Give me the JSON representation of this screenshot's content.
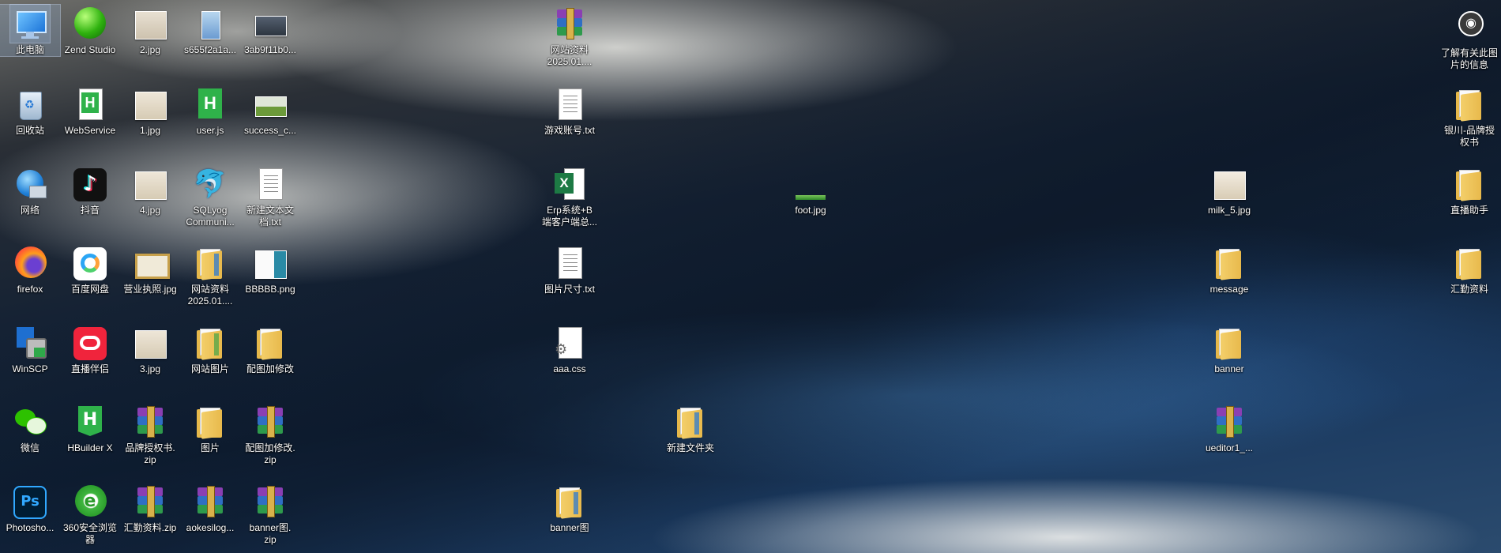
{
  "desktop": {
    "icons": [
      {
        "label": "此电脑",
        "icon": "computer-icon",
        "selected": true
      },
      {
        "label": "Zend Studio",
        "icon": "zend-studio-icon"
      },
      {
        "label": "2.jpg",
        "icon": "image-icon"
      },
      {
        "label": "s655f2a1a...",
        "icon": "image-icon"
      },
      {
        "label": "3ab9f11b0...",
        "icon": "image-icon"
      },
      {
        "label": "网站资料\n2025.01....",
        "icon": "zip-icon"
      },
      {
        "label": "了解有关此图\n片的信息",
        "icon": "info-camera-icon"
      },
      {
        "label": "回收站",
        "icon": "recycle-bin-icon"
      },
      {
        "label": "WebService",
        "icon": "hbuilder-file-icon"
      },
      {
        "label": "1.jpg",
        "icon": "image-icon"
      },
      {
        "label": "user.js",
        "icon": "hbuilder-file-icon"
      },
      {
        "label": "success_c...",
        "icon": "image-icon"
      },
      {
        "label": "游戏账号.txt",
        "icon": "text-file-icon"
      },
      {
        "label": "银川-品牌授\n权书",
        "icon": "folder-icon"
      },
      {
        "label": "网络",
        "icon": "network-icon"
      },
      {
        "label": "抖音",
        "icon": "douyin-icon"
      },
      {
        "label": "4.jpg",
        "icon": "image-icon"
      },
      {
        "label": "SQLyog\nCommuni...",
        "icon": "sqlyog-icon"
      },
      {
        "label": "新建文本文\n档.txt",
        "icon": "text-file-icon"
      },
      {
        "label": "Erp系统+B\n端客户端总...",
        "icon": "excel-icon"
      },
      {
        "label": "foot.jpg",
        "icon": "image-icon"
      },
      {
        "label": "milk_5.jpg",
        "icon": "image-icon"
      },
      {
        "label": "直播助手",
        "icon": "folder-icon"
      },
      {
        "label": "firefox",
        "icon": "firefox-icon"
      },
      {
        "label": "百度网盘",
        "icon": "baidu-netdisk-icon"
      },
      {
        "label": "营业执照.jpg",
        "icon": "image-icon"
      },
      {
        "label": "网站资料\n2025.01....",
        "icon": "folder-icon"
      },
      {
        "label": "BBBBB.png",
        "icon": "image-icon"
      },
      {
        "label": "图片尺寸.txt",
        "icon": "text-file-icon"
      },
      {
        "label": "message",
        "icon": "folder-icon"
      },
      {
        "label": "汇勤资料",
        "icon": "folder-icon"
      },
      {
        "label": "WinSCP",
        "icon": "winscp-icon"
      },
      {
        "label": "直播伴侣",
        "icon": "live-companion-icon"
      },
      {
        "label": "3.jpg",
        "icon": "image-icon"
      },
      {
        "label": "网站图片",
        "icon": "folder-icon"
      },
      {
        "label": "配图加修改",
        "icon": "folder-icon"
      },
      {
        "label": "aaa.css",
        "icon": "css-file-icon"
      },
      {
        "label": "banner",
        "icon": "folder-icon"
      },
      {
        "label": "微信",
        "icon": "wechat-icon"
      },
      {
        "label": "HBuilder X",
        "icon": "hbuilder-icon"
      },
      {
        "label": "品牌授权书.\nzip",
        "icon": "zip-icon"
      },
      {
        "label": "图片",
        "icon": "folder-icon"
      },
      {
        "label": "配图加修改.\nzip",
        "icon": "zip-icon"
      },
      {
        "label": "新建文件夹",
        "icon": "folder-icon"
      },
      {
        "label": "ueditor1_...",
        "icon": "zip-icon"
      },
      {
        "label": "Photosho...",
        "icon": "photoshop-icon"
      },
      {
        "label": "360安全浏览\n器",
        "icon": "360-browser-icon"
      },
      {
        "label": "汇勤资料.zip",
        "icon": "zip-icon"
      },
      {
        "label": "aokesilog...",
        "icon": "zip-icon"
      },
      {
        "label": "banner图.\nzip",
        "icon": "zip-icon"
      },
      {
        "label": "banner图",
        "icon": "folder-icon"
      }
    ]
  }
}
